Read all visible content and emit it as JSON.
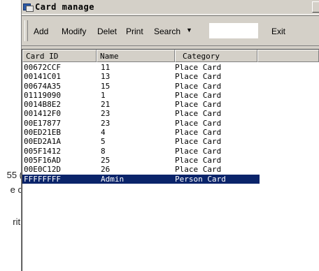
{
  "background_text": {
    "fragment_1": "55 (",
    "fragment_2": "e c",
    "fragment_3": "riti"
  },
  "window": {
    "title": "Card manage"
  },
  "toolbar": {
    "add_label": "Add",
    "modify_label": "Modify",
    "delet_label": "Delet",
    "print_label": "Print",
    "search_label": "Search",
    "search_arrow": "▼",
    "search_value": "",
    "exit_label": "Exit"
  },
  "table": {
    "columns": [
      "Card ID",
      "Name",
      "Category"
    ],
    "rows": [
      {
        "id": "00672CCF",
        "name": "11",
        "category": "Place Card"
      },
      {
        "id": "00141C01",
        "name": "13",
        "category": "Place Card"
      },
      {
        "id": "00674A35",
        "name": "15",
        "category": "Place Card"
      },
      {
        "id": "01119090",
        "name": "1",
        "category": "Place Card"
      },
      {
        "id": "0014B8E2",
        "name": "21",
        "category": "Place Card"
      },
      {
        "id": "001412F0",
        "name": "23",
        "category": "Place Card"
      },
      {
        "id": "00E17877",
        "name": "23",
        "category": "Place Card"
      },
      {
        "id": "00ED21EB",
        "name": "4",
        "category": "Place Card"
      },
      {
        "id": "00ED2A1A",
        "name": "5",
        "category": "Place Card"
      },
      {
        "id": "005F1412",
        "name": "8",
        "category": "Place Card"
      },
      {
        "id": "005F16AD",
        "name": "25",
        "category": "Place Card"
      },
      {
        "id": "00E0C12D",
        "name": "26",
        "category": "Place Card"
      },
      {
        "id": "FFFFFFFF",
        "name": "Admin",
        "category": "Person Card",
        "selected": true
      }
    ]
  },
  "colors": {
    "selection": "#0a246a",
    "window_face": "#d4d0c8"
  },
  "icons": {
    "title_icon": "card-stack-icon",
    "search_dropdown": "dropdown-arrow-icon"
  }
}
